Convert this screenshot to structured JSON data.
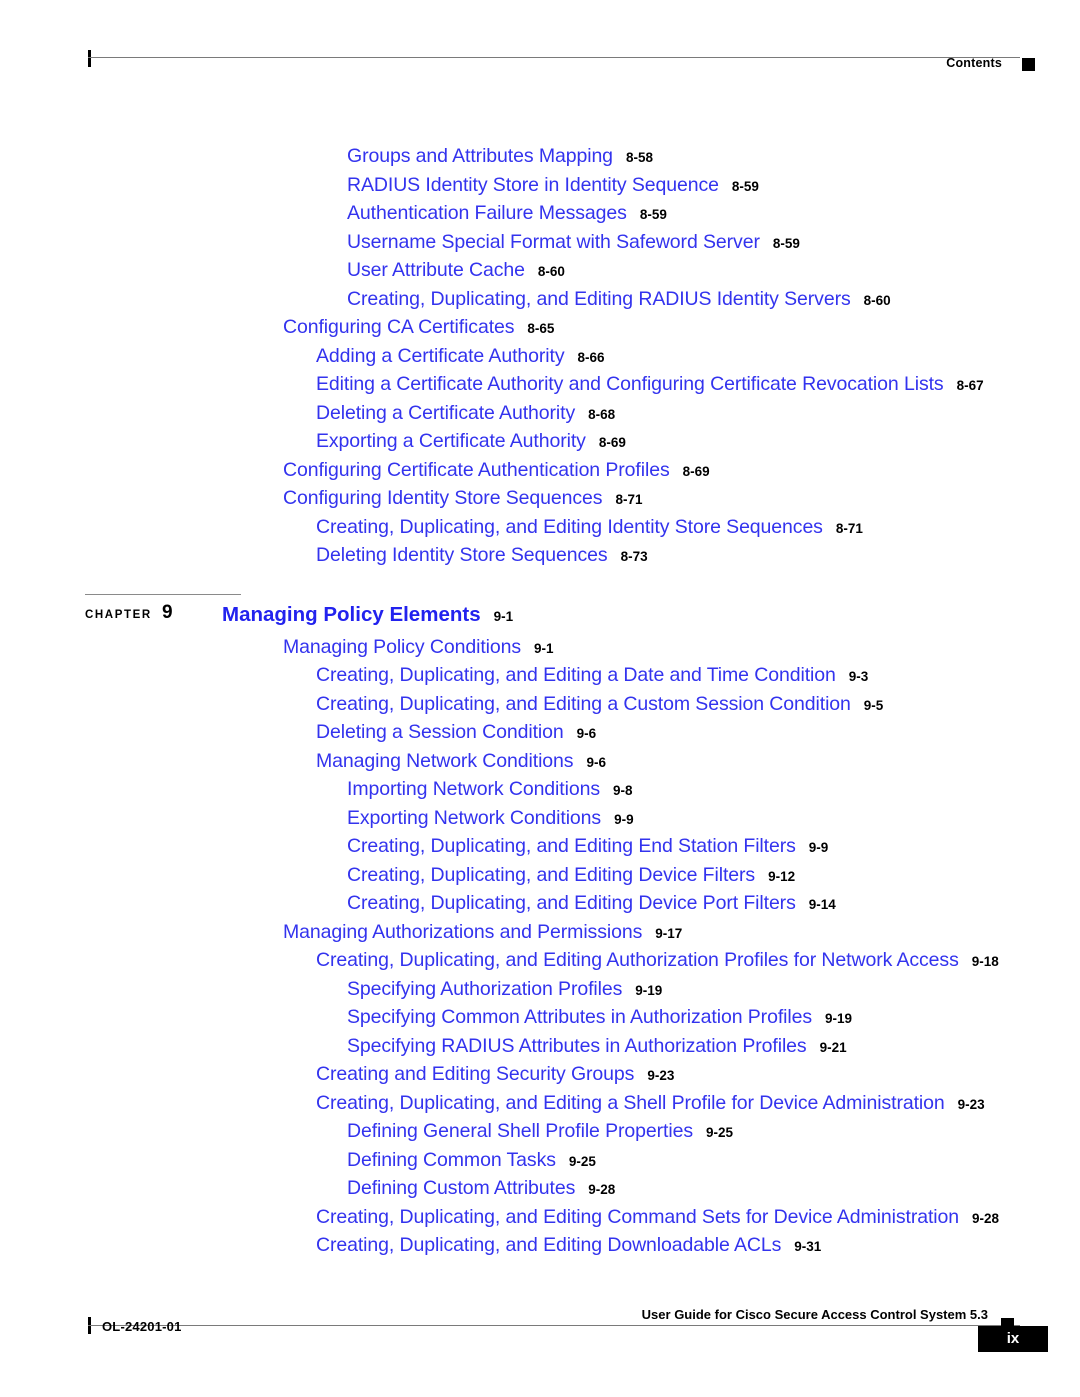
{
  "header": {
    "label": "Contents"
  },
  "toc": {
    "entries": [
      {
        "title": "Groups and Attributes Mapping",
        "page": "8-58",
        "level": 3
      },
      {
        "title": "RADIUS Identity Store in Identity Sequence",
        "page": "8-59",
        "level": 3
      },
      {
        "title": "Authentication Failure Messages",
        "page": "8-59",
        "level": 3
      },
      {
        "title": "Username Special Format with Safeword Server",
        "page": "8-59",
        "level": 3
      },
      {
        "title": "User Attribute Cache",
        "page": "8-60",
        "level": 3
      },
      {
        "title": "Creating, Duplicating, and Editing RADIUS Identity Servers",
        "page": "8-60",
        "level": 3
      },
      {
        "title": "Configuring CA Certificates",
        "page": "8-65",
        "level": 1
      },
      {
        "title": "Adding a Certificate Authority",
        "page": "8-66",
        "level": 2
      },
      {
        "title": "Editing a Certificate Authority and Configuring Certificate Revocation Lists",
        "page": "8-67",
        "level": 2
      },
      {
        "title": "Deleting a Certificate Authority",
        "page": "8-68",
        "level": 2
      },
      {
        "title": "Exporting a Certificate Authority",
        "page": "8-69",
        "level": 2
      },
      {
        "title": "Configuring Certificate Authentication Profiles",
        "page": "8-69",
        "level": 1
      },
      {
        "title": "Configuring Identity Store Sequences",
        "page": "8-71",
        "level": 1
      },
      {
        "title": "Creating, Duplicating, and Editing Identity Store Sequences",
        "page": "8-71",
        "level": 2
      },
      {
        "title": "Deleting Identity Store Sequences",
        "page": "8-73",
        "level": 2
      }
    ]
  },
  "chapter": {
    "word": "CHAPTER",
    "number": "9",
    "title": "Managing Policy Elements",
    "page": "9-1"
  },
  "toc_chapter9": {
    "entries": [
      {
        "title": "Managing Policy Conditions",
        "page": "9-1",
        "level": 1
      },
      {
        "title": "Creating, Duplicating, and Editing a Date and Time Condition",
        "page": "9-3",
        "level": 2
      },
      {
        "title": "Creating, Duplicating, and Editing a Custom Session Condition",
        "page": "9-5",
        "level": 2
      },
      {
        "title": "Deleting a Session Condition",
        "page": "9-6",
        "level": 2
      },
      {
        "title": "Managing Network Conditions",
        "page": "9-6",
        "level": 2
      },
      {
        "title": "Importing Network Conditions",
        "page": "9-8",
        "level": 3
      },
      {
        "title": "Exporting Network Conditions",
        "page": "9-9",
        "level": 3
      },
      {
        "title": "Creating, Duplicating, and Editing End Station Filters",
        "page": "9-9",
        "level": 3
      },
      {
        "title": "Creating, Duplicating, and Editing Device Filters",
        "page": "9-12",
        "level": 3
      },
      {
        "title": "Creating, Duplicating, and Editing Device Port Filters",
        "page": "9-14",
        "level": 3
      },
      {
        "title": "Managing Authorizations and Permissions",
        "page": "9-17",
        "level": 1
      },
      {
        "title": "Creating, Duplicating, and Editing Authorization Profiles for Network Access",
        "page": "9-18",
        "level": 2
      },
      {
        "title": "Specifying Authorization Profiles",
        "page": "9-19",
        "level": 3
      },
      {
        "title": "Specifying Common Attributes in Authorization Profiles",
        "page": "9-19",
        "level": 3
      },
      {
        "title": "Specifying RADIUS Attributes in Authorization Profiles",
        "page": "9-21",
        "level": 3
      },
      {
        "title": "Creating and Editing Security Groups",
        "page": "9-23",
        "level": 2
      },
      {
        "title": "Creating, Duplicating, and Editing a Shell Profile for Device Administration",
        "page": "9-23",
        "level": 2
      },
      {
        "title": "Defining General Shell Profile Properties",
        "page": "9-25",
        "level": 3
      },
      {
        "title": "Defining Common Tasks",
        "page": "9-25",
        "level": 3
      },
      {
        "title": "Defining Custom Attributes",
        "page": "9-28",
        "level": 3
      },
      {
        "title": "Creating, Duplicating, and Editing Command Sets for Device Administration",
        "page": "9-28",
        "level": 2
      },
      {
        "title": "Creating, Duplicating, and Editing Downloadable ACLs",
        "page": "9-31",
        "level": 2
      }
    ]
  },
  "footer": {
    "doc_id": "OL-24201-01",
    "guide_title": "User Guide for Cisco Secure Access Control System 5.3",
    "page_number": "ix"
  }
}
